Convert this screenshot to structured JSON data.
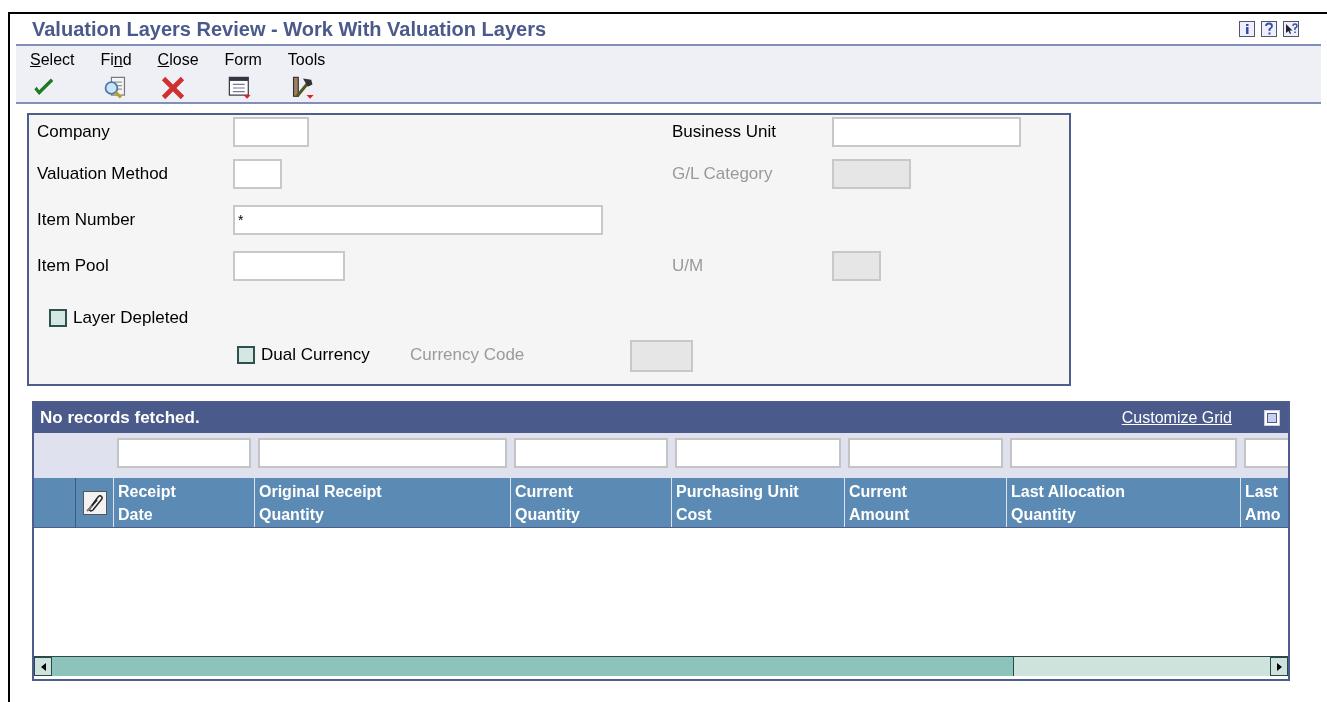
{
  "window": {
    "title": "Valuation Layers Review - Work With Valuation Layers"
  },
  "help_icons": [
    {
      "kind": "info"
    },
    {
      "kind": "help"
    },
    {
      "kind": "whats_this"
    }
  ],
  "toolbar": [
    {
      "label": "Select",
      "kind": "check"
    },
    {
      "label": "Find",
      "kind": "find"
    },
    {
      "label": "Close",
      "kind": "close"
    },
    {
      "label": "Form",
      "kind": "form"
    },
    {
      "label": "Tools",
      "kind": "tools"
    }
  ],
  "form": {
    "left": [
      {
        "kind": "field",
        "label": "Company",
        "disabled": false
      },
      {
        "kind": "field",
        "label": "Valuation Method",
        "disabled": false
      },
      {
        "kind": "field",
        "label": "Item Number",
        "value": "*",
        "disabled": false
      },
      {
        "kind": "field",
        "label": "Item Pool",
        "disabled": false
      },
      {
        "kind": "checkbox",
        "label": "Layer Depleted",
        "checked": false
      }
    ],
    "right": [
      {
        "label": "Business Unit",
        "disabled": false
      },
      {
        "label": "G/L Category",
        "disabled": true
      },
      {
        "label": "U/M",
        "disabled": true
      }
    ],
    "dual_currency": {
      "label": "Dual Currency",
      "checked": false
    },
    "currency_code": {
      "label": "Currency Code",
      "disabled": true
    }
  },
  "grid": {
    "status": "No records fetched.",
    "customize_link": "Customize Grid",
    "columns": [
      {
        "label": "Receipt Date"
      },
      {
        "label": "Original Receipt Quantity"
      },
      {
        "label": "Current Quantity"
      },
      {
        "label": "Purchasing Unit Cost"
      },
      {
        "label": "Current Amount"
      },
      {
        "label": "Last Allocation Quantity"
      },
      {
        "label": "Last Amo"
      }
    ]
  }
}
